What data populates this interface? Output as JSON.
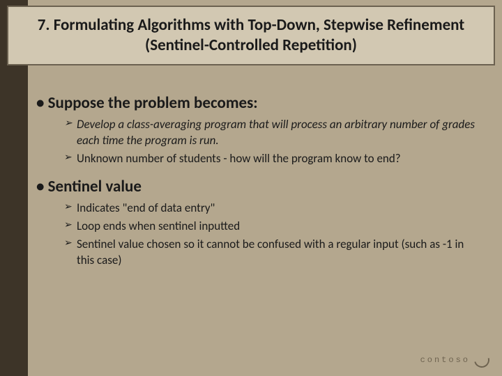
{
  "title": "7. Formulating Algorithms with Top-Down, Stepwise Refinement (Sentinel-Controlled Repetition)",
  "section1": {
    "heading": "Suppose the problem becomes:",
    "items": [
      "Develop a class-averaging program that will process an arbitrary number of grades each time the program is run.",
      "Unknown number of students - how will the program know to end?"
    ]
  },
  "section2": {
    "heading": "Sentinel value",
    "items": [
      "Indicates \"end of data entry\"",
      "Loop ends when sentinel inputted",
      "Sentinel value chosen so it cannot be confused with a regular input (such as -1 in this case)"
    ]
  },
  "logo": "contoso"
}
